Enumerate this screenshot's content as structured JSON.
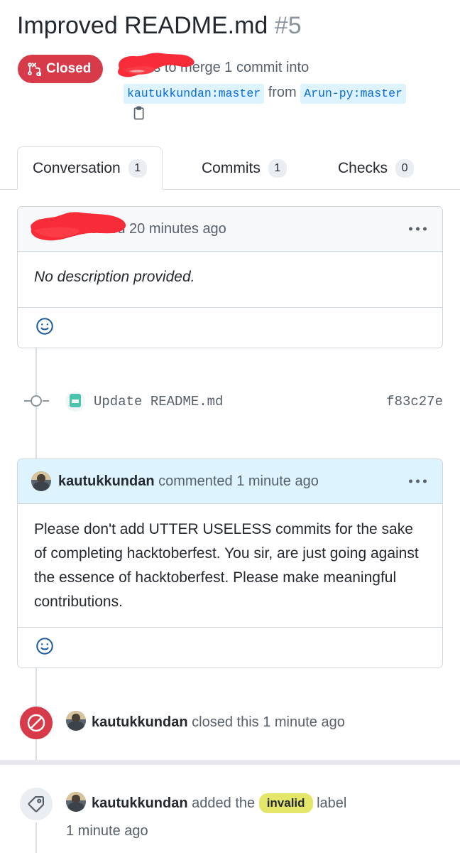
{
  "pr": {
    "title": "Improved README.md",
    "number": "#5",
    "state": "Closed",
    "state_icon": "pull-request-closed-icon",
    "state_color": "#d73a49",
    "subline_author_redacted": true,
    "subline_prefix": "wants to merge 1 commit into",
    "base_branch": "kautukkundan:master",
    "from_word": "from",
    "head_branch": "Arun-py:master",
    "copy_icon": "copy-icon",
    "branch_chip_bg": "#ddf4ff",
    "branch_chip_fg": "#0969da"
  },
  "tabs": [
    {
      "label": "Conversation",
      "count": "1",
      "active": true
    },
    {
      "label": "Commits",
      "count": "1",
      "active": false
    },
    {
      "label": "Checks",
      "count": "0",
      "active": false
    }
  ],
  "comments": [
    {
      "author_redacted": true,
      "action": "commented",
      "time": "20 minutes ago",
      "header_suffix": "ommented 20 minutes ago",
      "body": "No description provided.",
      "body_italic": true,
      "reaction_icon": "smiley-add-reaction-icon",
      "menu_icon": "kebab-horizontal-icon",
      "header_bg": "#f6f8fa"
    },
    {
      "author": "kautukkundan",
      "action": "commented",
      "time": "1 minute ago",
      "body": "Please don't add UTTER USELESS commits for the sake of completing hacktoberfest. You sir, are just going against the essence of hacktoberfest. Please make meaningful contributions.",
      "body_italic": false,
      "reaction_icon": "smiley-add-reaction-icon",
      "menu_icon": "kebab-horizontal-icon",
      "header_bg": "#ddf4ff"
    }
  ],
  "commit": {
    "message": "Update README.md",
    "sha": "f83c27e",
    "avatar_icon": "commit-author-avatar"
  },
  "events": [
    {
      "icon": "closed-circle-slash-icon",
      "icon_bg": "#d73a49",
      "author": "kautukkundan",
      "action": "closed this",
      "time": "1 minute ago"
    },
    {
      "icon": "tag-label-icon",
      "icon_bg": "#eaeef2",
      "author": "kautukkundan",
      "action_before": "added the",
      "label": "invalid",
      "label_color": "#e4e669",
      "action_after": "label",
      "time": "1 minute ago"
    }
  ]
}
